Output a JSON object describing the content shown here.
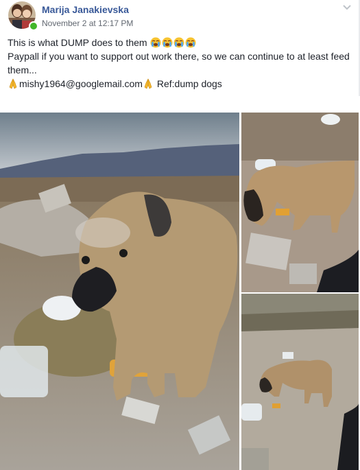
{
  "post": {
    "author": "Marija Janakievska",
    "timestamp": "November 2 at 12:17 PM",
    "lines": [
      "This is what DUMP does to them",
      "Paypall if you want to support out work there, so we can continue to at least feed them...",
      "mishy1964@googlemail.com",
      "Ref:dump dogs"
    ],
    "icons": {
      "avatar": "profile-photo",
      "online": "online-dot",
      "options": "chevron-down-icon",
      "crying_emoji": "loudly-crying-face",
      "praying_emoji": "folded-hands"
    },
    "colors": {
      "author_link": "#385898",
      "meta_text": "#616770",
      "body_text": "#1d2129",
      "online_dot": "#42b72a"
    }
  }
}
